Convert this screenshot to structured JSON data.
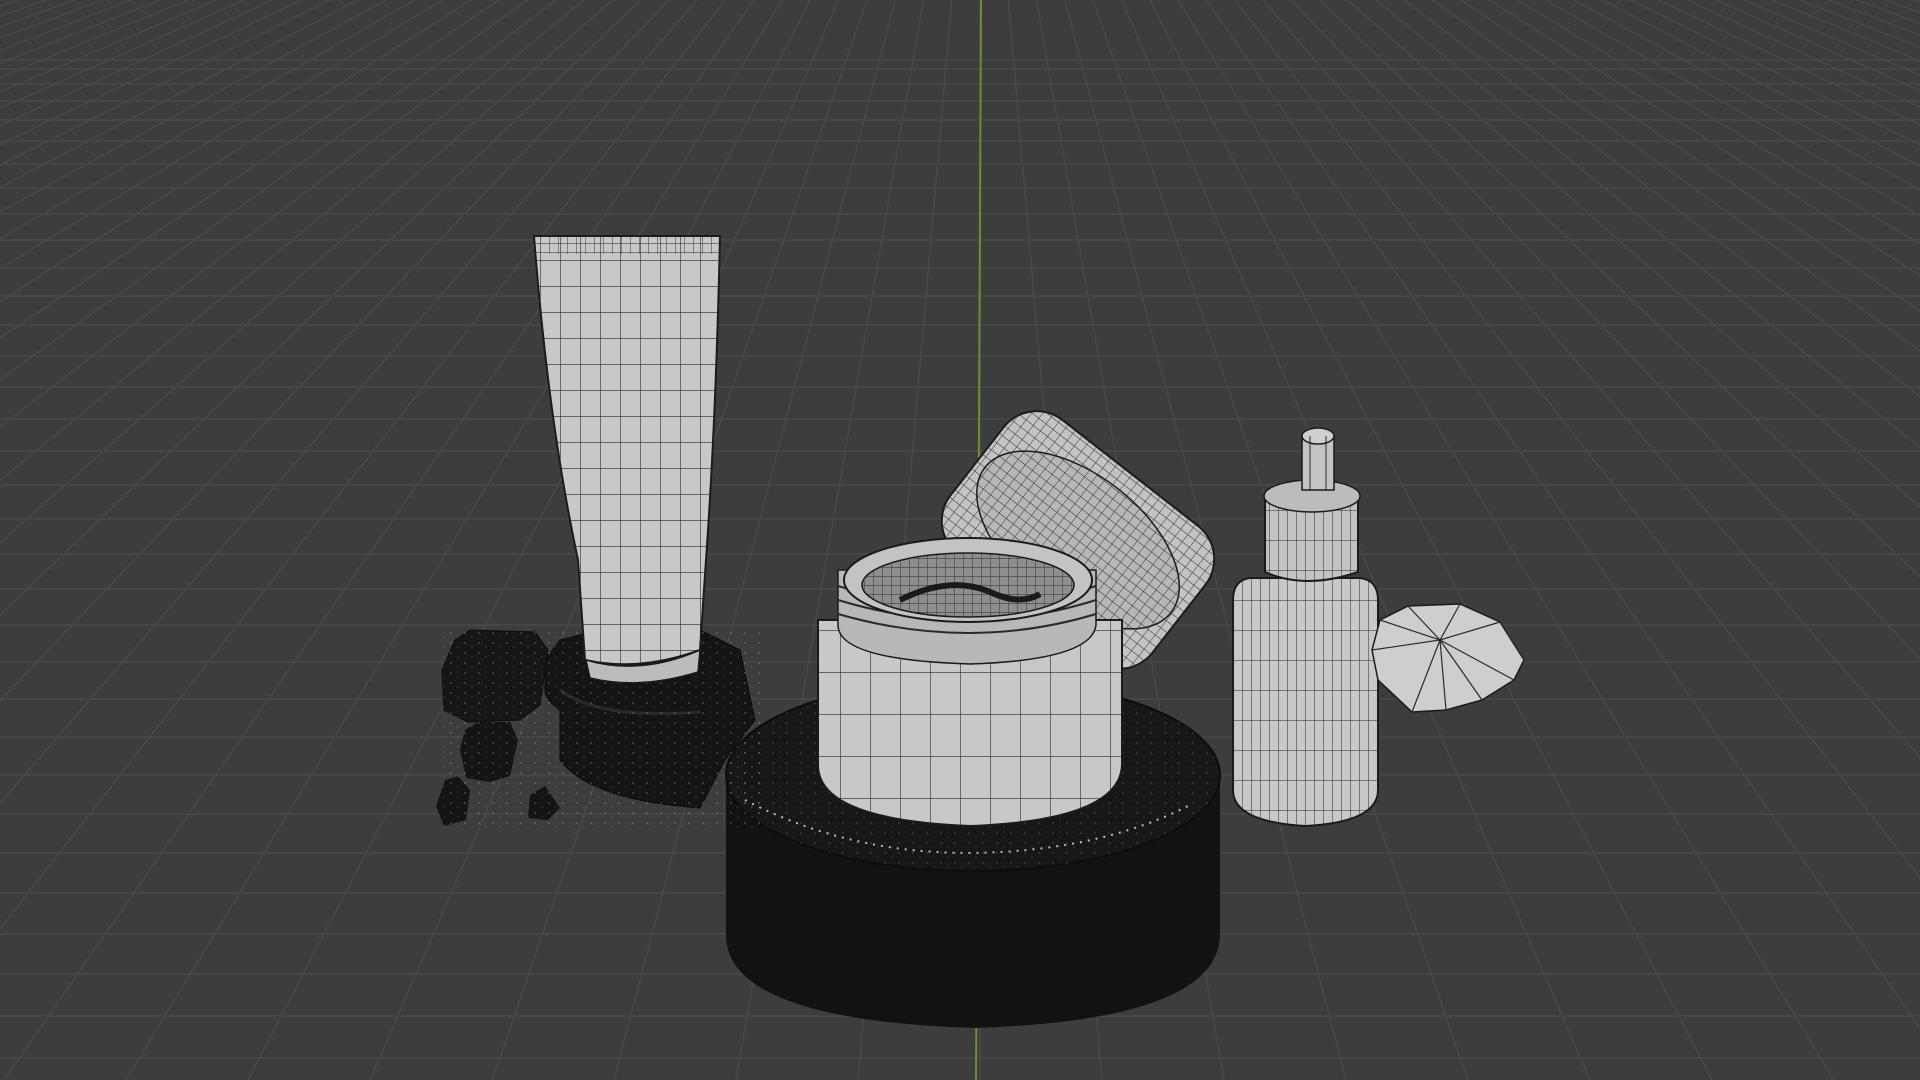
{
  "app": {
    "viewport_mode": "wireframe-overlay",
    "background_color": "#3d3d3d",
    "grid_line_color": "#4b4b4b",
    "y_axis_color": "#6c8f2b",
    "light_mesh_color": "#c9c7c7",
    "dark_mesh_color": "#121212",
    "wire_color": "#2a2a2a"
  },
  "scene": {
    "objects": [
      {
        "id": "tube",
        "name": "cream-tube"
      },
      {
        "id": "rocks",
        "name": "black-rocks"
      },
      {
        "id": "pedestal",
        "name": "cylinder-pedestal"
      },
      {
        "id": "jar",
        "name": "cream-jar"
      },
      {
        "id": "lid",
        "name": "jar-lid"
      },
      {
        "id": "dropper",
        "name": "dropper-bottle"
      },
      {
        "id": "gem",
        "name": "faceted-gem"
      }
    ]
  }
}
